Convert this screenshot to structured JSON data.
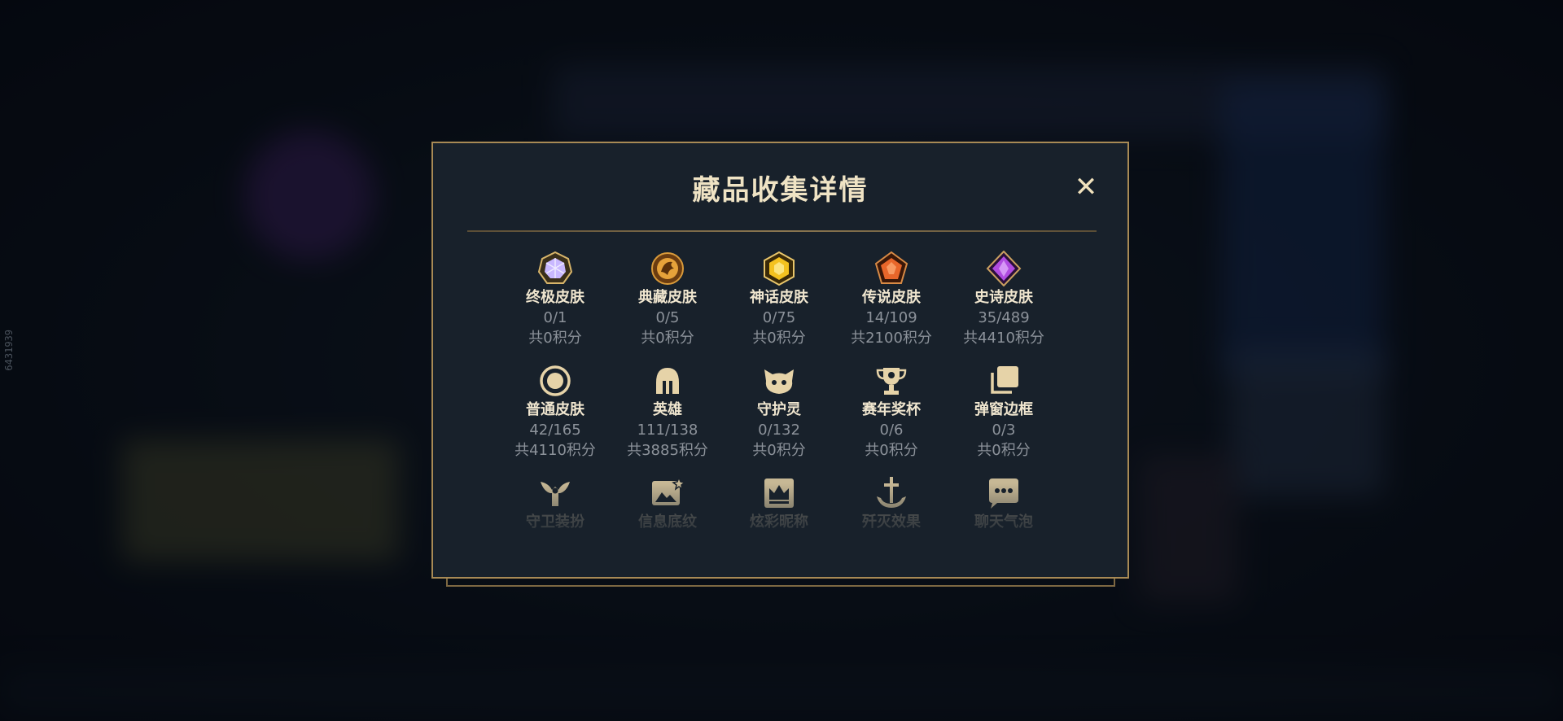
{
  "watermark": "6431939",
  "modal": {
    "title": "藏品收集详情",
    "close_label": "✕"
  },
  "categories": [
    {
      "name": "终极皮肤",
      "count": "0/1",
      "score": "共0积分",
      "icon": "ultimate-gem-icon",
      "color": "#c9b8ff"
    },
    {
      "name": "典藏皮肤",
      "count": "0/5",
      "score": "共0积分",
      "icon": "dragon-emblem-icon",
      "color": "#e6a23a"
    },
    {
      "name": "神话皮肤",
      "count": "0/75",
      "score": "共0积分",
      "icon": "mythic-gem-icon",
      "color": "#f4c21f"
    },
    {
      "name": "传说皮肤",
      "count": "14/109",
      "score": "共2100积分",
      "icon": "legendary-gem-icon",
      "color": "#e8662a"
    },
    {
      "name": "史诗皮肤",
      "count": "35/489",
      "score": "共4410积分",
      "icon": "epic-gem-icon",
      "color": "#b04be0"
    },
    {
      "name": "普通皮肤",
      "count": "42/165",
      "score": "共4110积分",
      "icon": "ring-icon",
      "color": "#e6d3a8"
    },
    {
      "name": "英雄",
      "count": "111/138",
      "score": "共3885积分",
      "icon": "helmet-icon",
      "color": "#e6d3a8"
    },
    {
      "name": "守护灵",
      "count": "0/132",
      "score": "共0积分",
      "icon": "little-legend-icon",
      "color": "#e6d3a8"
    },
    {
      "name": "赛年奖杯",
      "count": "0/6",
      "score": "共0积分",
      "icon": "trophy-icon",
      "color": "#e6d3a8"
    },
    {
      "name": "弹窗边框",
      "count": "0/3",
      "score": "共0积分",
      "icon": "frame-stack-icon",
      "color": "#e6d3a8"
    },
    {
      "name": "守卫装扮",
      "icon": "ward-icon",
      "color": "#e6d3a8"
    },
    {
      "name": "信息底纹",
      "icon": "banner-image-icon",
      "color": "#e6d3a8"
    },
    {
      "name": "炫彩昵称",
      "icon": "crown-card-icon",
      "color": "#e6d3a8"
    },
    {
      "name": "歼灭效果",
      "icon": "anchor-sword-icon",
      "color": "#e6d3a8"
    },
    {
      "name": "聊天气泡",
      "icon": "chat-bubble-icon",
      "color": "#e6d3a8"
    }
  ]
}
